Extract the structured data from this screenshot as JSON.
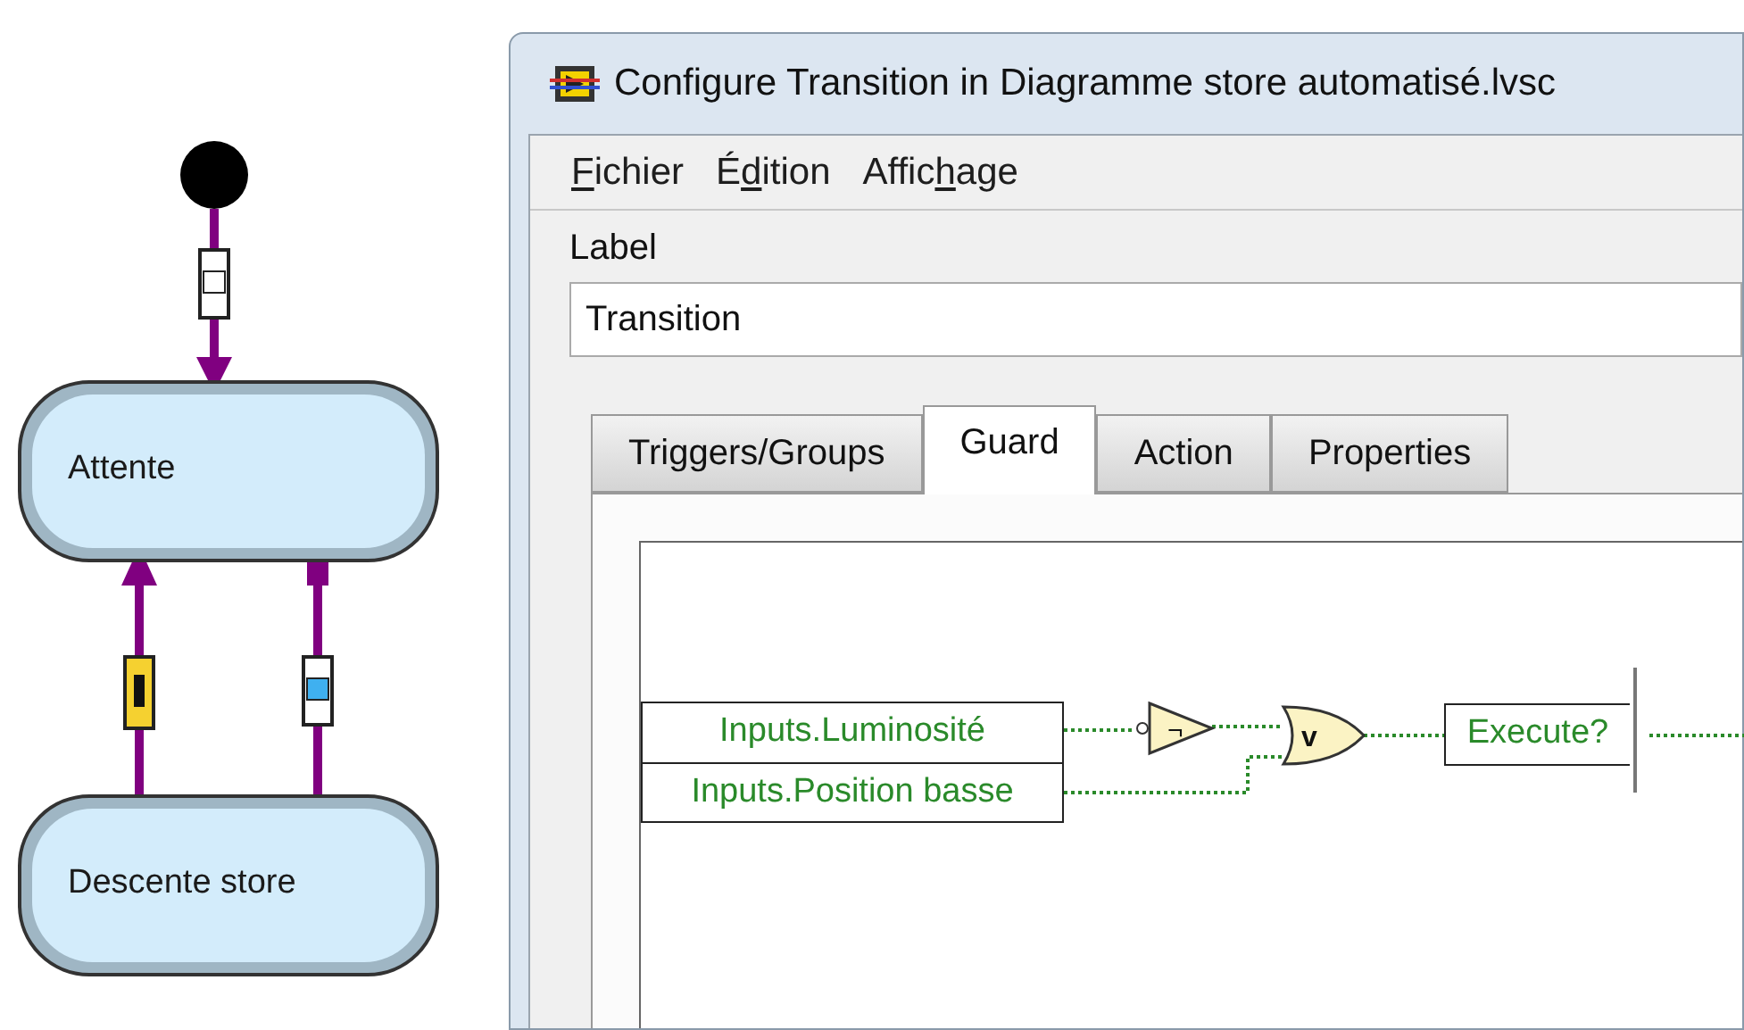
{
  "diagram": {
    "states": [
      {
        "name": "Attente"
      },
      {
        "name": "Descente store"
      }
    ]
  },
  "window": {
    "title": "Configure Transition in Diagramme store automatisé.lvsc",
    "menu": [
      {
        "key": "F",
        "after": "ichier"
      },
      {
        "before": "É",
        "key": "d",
        "after": "ition"
      },
      {
        "before": "Affic",
        "key": "h",
        "after": "age"
      }
    ],
    "label_caption": "Label",
    "label_value": "Transition",
    "tabs": [
      {
        "label": "Triggers/Groups",
        "selected": false
      },
      {
        "label": "Guard",
        "selected": true
      },
      {
        "label": "Action",
        "selected": false
      },
      {
        "label": "Properties",
        "selected": false
      }
    ],
    "guard": {
      "inputs": [
        "Inputs.Luminosité",
        "Inputs.Position basse"
      ],
      "gates": [
        {
          "kind": "not",
          "symbol": "¬"
        },
        {
          "kind": "or",
          "symbol": "v"
        }
      ],
      "output": "Execute?"
    }
  }
}
